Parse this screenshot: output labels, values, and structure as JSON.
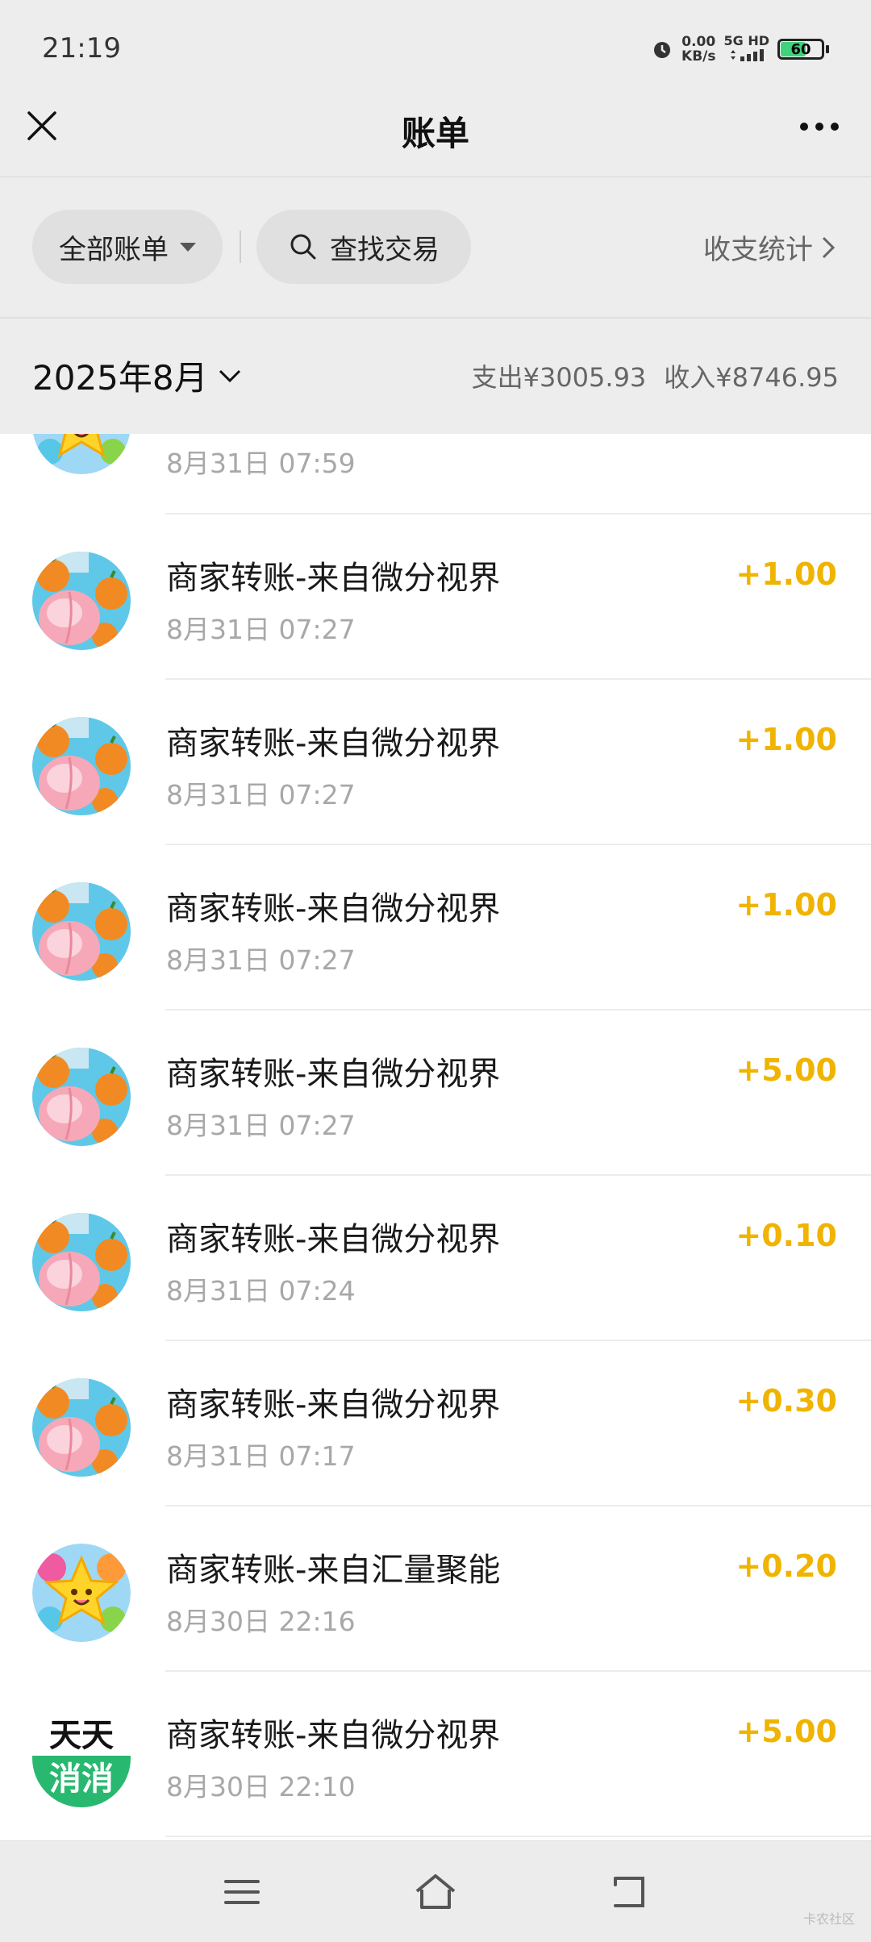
{
  "status_bar": {
    "time": "21:19",
    "net_speed_value": "0.00",
    "net_speed_unit": "KB/s",
    "net_type": "5G HD",
    "battery": "60"
  },
  "header": {
    "title": "账单"
  },
  "filters": {
    "all_bills": "全部账单",
    "search": "查找交易",
    "stats": "收支统计"
  },
  "month": {
    "label": "2025年8月",
    "expense": "支出¥3005.93",
    "income": "收入¥8746.95"
  },
  "transactions": [
    {
      "desc": "",
      "time": "8月31日 07:59",
      "amount": "",
      "icon": "star-game-icon"
    },
    {
      "desc": "商家转账-来自微分视界",
      "time": "8月31日 07:27",
      "amount": "+1.00",
      "icon": "fruit-game-icon"
    },
    {
      "desc": "商家转账-来自微分视界",
      "time": "8月31日 07:27",
      "amount": "+1.00",
      "icon": "fruit-game-icon"
    },
    {
      "desc": "商家转账-来自微分视界",
      "time": "8月31日 07:27",
      "amount": "+1.00",
      "icon": "fruit-game-icon"
    },
    {
      "desc": "商家转账-来自微分视界",
      "time": "8月31日 07:27",
      "amount": "+5.00",
      "icon": "fruit-game-icon"
    },
    {
      "desc": "商家转账-来自微分视界",
      "time": "8月31日 07:24",
      "amount": "+0.10",
      "icon": "fruit-game-icon"
    },
    {
      "desc": "商家转账-来自微分视界",
      "time": "8月31日 07:17",
      "amount": "+0.30",
      "icon": "fruit-game-icon"
    },
    {
      "desc": "商家转账-来自汇量聚能",
      "time": "8月30日 22:16",
      "amount": "+0.20",
      "icon": "star-game-icon"
    },
    {
      "desc": "商家转账-来自微分视界",
      "time": "8月30日 22:10",
      "amount": "+5.00",
      "icon": "tiantian-xiaoxiao-icon"
    }
  ],
  "tiantian_logo": {
    "top": "天天",
    "bottom": "消消"
  },
  "watermark": "卡农社区",
  "colors": {
    "amount": "#f0b400",
    "background": "#ededed"
  }
}
